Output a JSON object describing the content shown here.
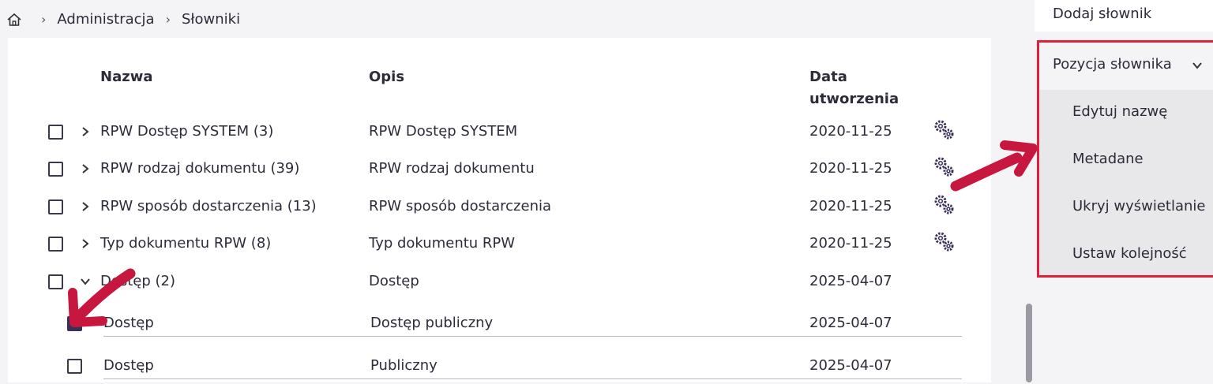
{
  "breadcrumb": {
    "home_icon": "home-icon",
    "items": [
      "Administracja",
      "Słowniki"
    ]
  },
  "table": {
    "headers": {
      "name": "Nazwa",
      "description": "Opis",
      "date_line1": "Data",
      "date_line2": "utworzenia"
    },
    "rows": [
      {
        "name": "RPW Dostęp SYSTEM (3)",
        "description": "RPW Dostęp SYSTEM",
        "date": "2020-11-25"
      },
      {
        "name": "RPW rodzaj dokumentu (39)",
        "description": "RPW rodzaj dokumentu",
        "date": "2020-11-25"
      },
      {
        "name": "RPW sposób dostarczenia (13)",
        "description": "RPW sposób dostarczenia",
        "date": "2020-11-25"
      },
      {
        "name": "Typ dokumentu RPW (8)",
        "description": "Typ dokumentu RPW",
        "date": "2020-11-25"
      },
      {
        "name": "Dostęp (2)",
        "description": "Dostęp",
        "date": "2025-04-07"
      }
    ],
    "child_rows": [
      {
        "name": "Dostęp",
        "description": "Dostęp publiczny",
        "date": "2025-04-07",
        "checked": true
      },
      {
        "name": "Dostęp",
        "description": "Publiczny",
        "date": "2025-04-07",
        "checked": false
      }
    ]
  },
  "menu": {
    "add_dictionary": "Dodaj słownik",
    "group_label": "Pozycja słownika",
    "items": [
      "Edytuj nazwę",
      "Metadane",
      "Ukryj wyświetlanie",
      "Ustaw kolejność"
    ]
  },
  "colors": {
    "accent": "#3b2f58",
    "highlight": "#e0203a",
    "arrow": "#c8173f"
  }
}
